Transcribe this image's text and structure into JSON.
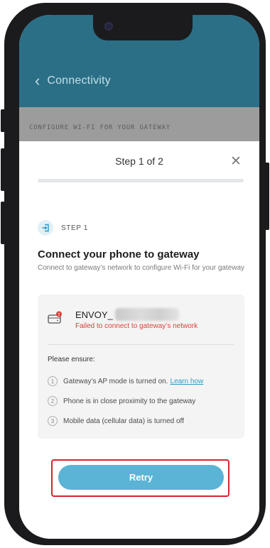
{
  "header": {
    "back_icon": "chevron-left-icon",
    "title": "Connectivity"
  },
  "section": {
    "title": "CONFIGURE WI-FI FOR YOUR GATEWAY"
  },
  "sheet": {
    "title": "Step 1 of 2",
    "close_icon": "close-icon",
    "progress_percent": 0,
    "step_label": "STEP 1",
    "heading": "Connect your phone to gateway",
    "subtext": "Connect to gateway’s network to configure Wi-Fi for your gateway"
  },
  "gateway_card": {
    "ssid_prefix": "ENVOY_",
    "status": "Failed to connect to gateway’s network",
    "ensure_title": "Please ensure:",
    "items": [
      {
        "number": "1",
        "text": "Gateway’s AP mode is turned on.",
        "link": "Learn how"
      },
      {
        "number": "2",
        "text": "Phone is in close proximity to the gateway"
      },
      {
        "number": "3",
        "text": "Mobile data (cellular data) is turned off"
      }
    ]
  },
  "actions": {
    "retry_label": "Retry"
  },
  "colors": {
    "header": "#2b6f86",
    "accent": "#5bb4d6",
    "error": "#d9413a",
    "highlight_frame": "#d6232f"
  }
}
